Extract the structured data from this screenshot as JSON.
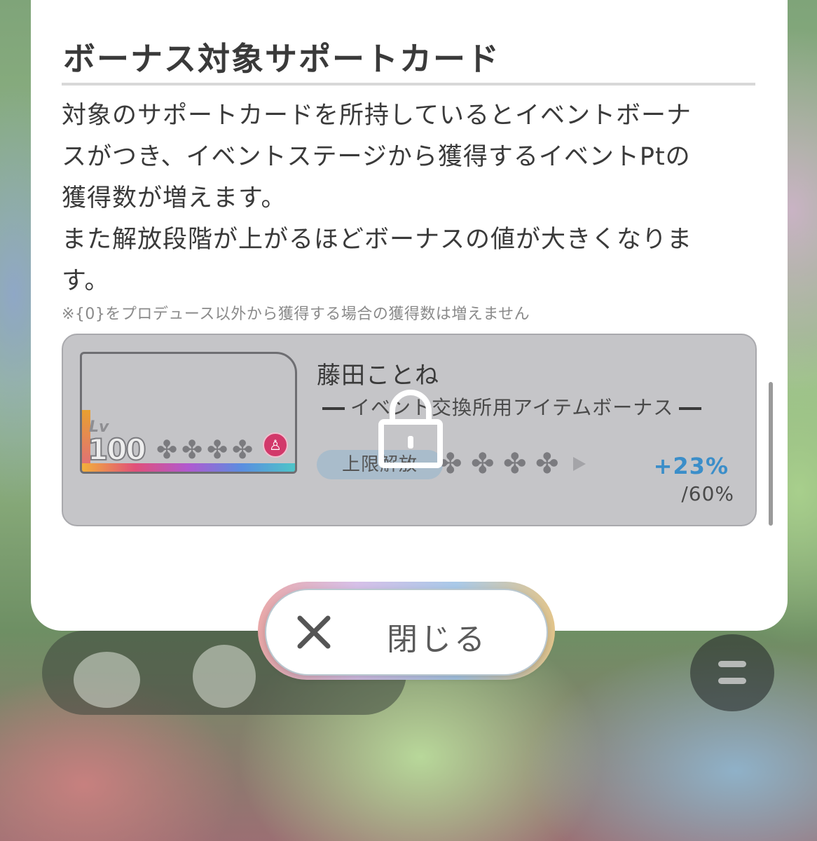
{
  "dialog": {
    "title": "ボーナス対象サポートカード",
    "description_lines": [
      "対象のサポートカードを所持しているとイベントボーナ",
      "スがつき、イベントステージから獲得するイベントPtの",
      "獲得数が増えます。",
      "また解放段階が上がるほどボーナスの値が大きくなりま",
      "す。"
    ],
    "note": "※{0}をプロデュース以外から獲得する場合の獲得数は増えません"
  },
  "card": {
    "level_label": "Lv",
    "level_value": "100",
    "name": "藤田ことね",
    "bonus_type": "イベント交換所用アイテムボーナス",
    "limit_break_label": "上限解放",
    "bonus_current": "+23%",
    "bonus_max": "/60%",
    "locked": true,
    "badge_icon": "microphone-icon",
    "star_icon": "clover-icon",
    "colors": {
      "bonus_current": "#3b8ec9",
      "badge": "#d2386a"
    }
  },
  "close_button": {
    "label": "閉じる",
    "icon": "close-icon"
  }
}
